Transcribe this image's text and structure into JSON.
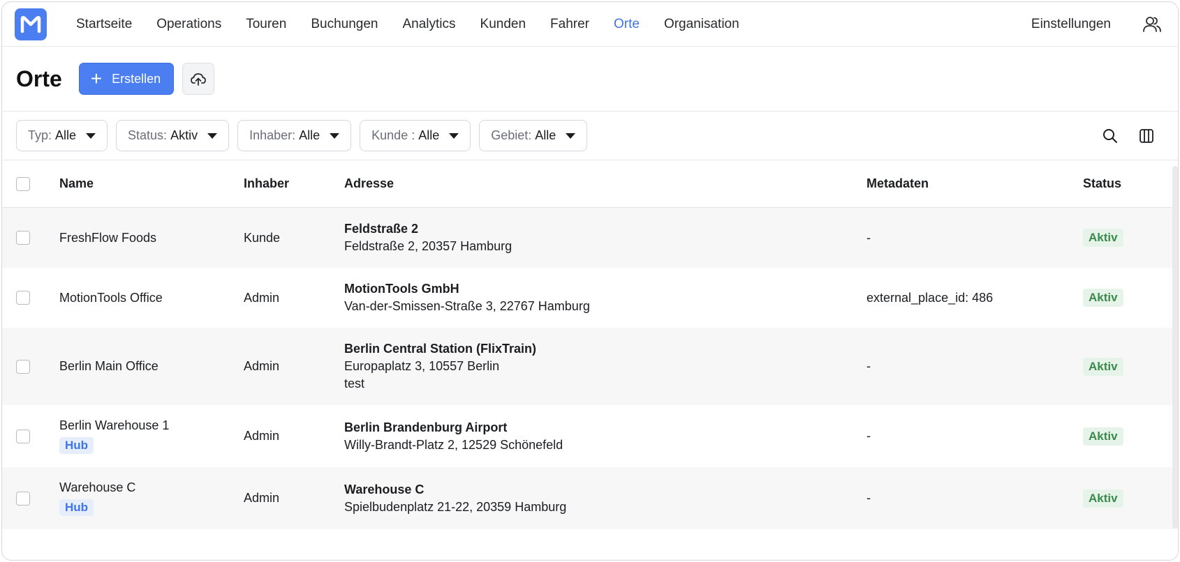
{
  "nav": {
    "items": [
      {
        "label": "Startseite",
        "active": false
      },
      {
        "label": "Operations",
        "active": false
      },
      {
        "label": "Touren",
        "active": false
      },
      {
        "label": "Buchungen",
        "active": false
      },
      {
        "label": "Analytics",
        "active": false
      },
      {
        "label": "Kunden",
        "active": false
      },
      {
        "label": "Fahrer",
        "active": false
      },
      {
        "label": "Orte",
        "active": true
      },
      {
        "label": "Organisation",
        "active": false
      }
    ],
    "settings_label": "Einstellungen",
    "accent_color": "#3f74e6"
  },
  "header": {
    "title": "Orte",
    "create_label": "Erstellen"
  },
  "filters": [
    {
      "label": "Typ:",
      "value": "Alle"
    },
    {
      "label": "Status:",
      "value": "Aktiv"
    },
    {
      "label": "Inhaber:",
      "value": "Alle"
    },
    {
      "label": "Kunde :",
      "value": "Alle"
    },
    {
      "label": "Gebiet:",
      "value": "Alle"
    }
  ],
  "table": {
    "columns": [
      "Name",
      "Inhaber",
      "Adresse",
      "Metadaten",
      "Status"
    ],
    "rows": [
      {
        "name": "FreshFlow Foods",
        "tag": "",
        "owner": "Kunde",
        "addr_title": "Feldstraße 2",
        "addr_line": "Feldstraße 2, 20357 Hamburg",
        "addr_note": "",
        "meta": "-",
        "status": "Aktiv"
      },
      {
        "name": "MotionTools Office",
        "tag": "",
        "owner": "Admin",
        "addr_title": "MotionTools GmbH",
        "addr_line": "Van-der-Smissen-Straße 3, 22767 Hamburg",
        "addr_note": "",
        "meta": "external_place_id: 486",
        "status": "Aktiv"
      },
      {
        "name": "Berlin Main Office",
        "tag": "",
        "owner": "Admin",
        "addr_title": "Berlin Central Station (FlixTrain)",
        "addr_line": "Europaplatz 3, 10557 Berlin",
        "addr_note": "test",
        "meta": "-",
        "status": "Aktiv"
      },
      {
        "name": "Berlin Warehouse 1",
        "tag": "Hub",
        "owner": "Admin",
        "addr_title": "Berlin Brandenburg Airport",
        "addr_line": "Willy-Brandt-Platz 2, 12529 Schönefeld",
        "addr_note": "",
        "meta": "-",
        "status": "Aktiv"
      },
      {
        "name": "Warehouse C",
        "tag": "Hub",
        "owner": "Admin",
        "addr_title": "Warehouse C",
        "addr_line": "Spielbudenplatz 21-22, 20359 Hamburg",
        "addr_note": "",
        "meta": "-",
        "status": "Aktiv"
      }
    ]
  }
}
